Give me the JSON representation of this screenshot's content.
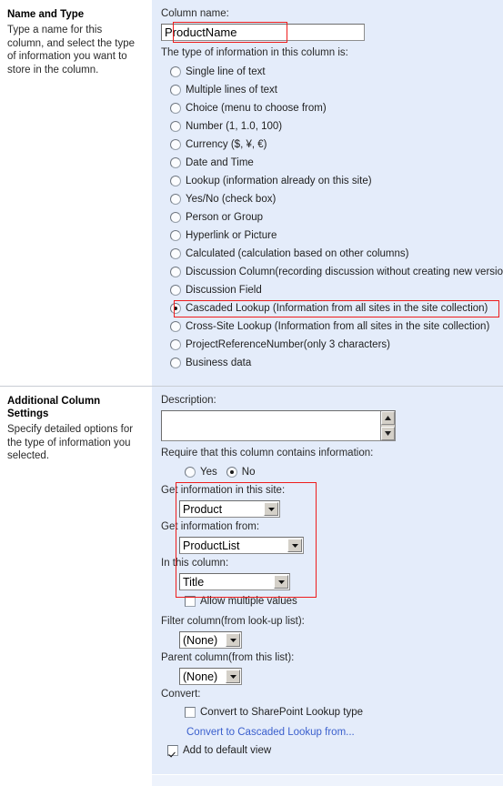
{
  "colors": {
    "panel_background": "#e4ecfa",
    "sidebar_background": "#ffffff",
    "annotation_red": "#ee1c1c",
    "link_blue": "#3a5fcd"
  },
  "name_and_type": {
    "heading": "Name and Type",
    "description": "Type a name for this column, and select the type of information you want to store in the column.",
    "column_name_label": "Column name:",
    "column_name_value": "ProductName",
    "column_name_placeholder": "",
    "type_label": "The type of information in this column is:",
    "type_options": [
      {
        "label": "Single line of text",
        "selected": false
      },
      {
        "label": "Multiple lines of text",
        "selected": false
      },
      {
        "label": "Choice (menu to choose from)",
        "selected": false
      },
      {
        "label": "Number (1, 1.0, 100)",
        "selected": false
      },
      {
        "label": "Currency ($, ¥, €)",
        "selected": false
      },
      {
        "label": "Date and Time",
        "selected": false
      },
      {
        "label": "Lookup (information already on this site)",
        "selected": false
      },
      {
        "label": "Yes/No (check box)",
        "selected": false
      },
      {
        "label": "Person or Group",
        "selected": false
      },
      {
        "label": "Hyperlink or Picture",
        "selected": false
      },
      {
        "label": "Calculated (calculation based on other columns)",
        "selected": false
      },
      {
        "label": "Discussion Column(recording discussion without creating new version)",
        "selected": false
      },
      {
        "label": "Discussion Field",
        "selected": false
      },
      {
        "label": "Cascaded Lookup (Information from all sites in the site collection)",
        "selected": true
      },
      {
        "label": "Cross-Site Lookup (Information from all sites in the site collection)",
        "selected": false
      },
      {
        "label": "ProjectReferenceNumber(only 3 characters)",
        "selected": false
      },
      {
        "label": "Business data",
        "selected": false
      }
    ]
  },
  "additional_settings": {
    "heading": "Additional Column Settings",
    "description": "Specify detailed options for the type of information you selected.",
    "description_label": "Description:",
    "description_value": "",
    "require_label": "Require that this column contains information:",
    "require_options": [
      {
        "label": "Yes",
        "selected": false
      },
      {
        "label": "No",
        "selected": true
      }
    ],
    "get_info_site_label": "Get information in this site:",
    "get_info_site_value": "Product",
    "get_info_from_label": "Get information from:",
    "get_info_from_value": "ProductList",
    "in_this_column_label": "In this column:",
    "in_this_column_value": "Title",
    "allow_multiple_label": "Allow multiple values",
    "allow_multiple_checked": false,
    "filter_column_label": "Filter column(from look-up list):",
    "filter_column_value": "(None)",
    "parent_column_label": "Parent column(from this list):",
    "parent_column_value": "(None)",
    "convert_label": "Convert:",
    "convert_sharepoint_label": "Convert to SharePoint Lookup type",
    "convert_sharepoint_checked": false,
    "convert_link_label": "Convert to Cascaded Lookup from...",
    "add_default_view_label": "Add to default view",
    "add_default_view_checked": true
  }
}
